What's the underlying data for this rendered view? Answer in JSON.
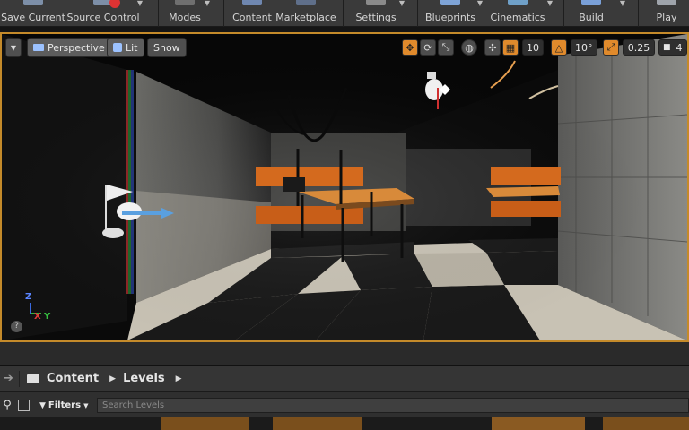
{
  "toolbar": {
    "save_current": "Save Current",
    "source_control": "Source Control",
    "modes": "Modes",
    "content": "Content",
    "marketplace": "Marketplace",
    "settings": "Settings",
    "blueprints": "Blueprints",
    "cinematics": "Cinematics",
    "build": "Build",
    "play": "Play"
  },
  "viewport": {
    "perspective": "Perspective",
    "lit": "Lit",
    "show": "Show",
    "grid_snap": "10",
    "rotation_snap": "10°",
    "scale_snap": "0.25",
    "camera_speed": "4",
    "axis_labels": {
      "z": "Z",
      "x": "X",
      "y": "Y"
    }
  },
  "content_browser": {
    "breadcrumb_root": "Content",
    "breadcrumb_folder": "Levels",
    "filters": "Filters",
    "search_placeholder": "Search Levels"
  },
  "colors": {
    "accent": "#c48a2a",
    "orange_button": "#e08a2c",
    "toolbar_bg": "#3a3a3a"
  }
}
